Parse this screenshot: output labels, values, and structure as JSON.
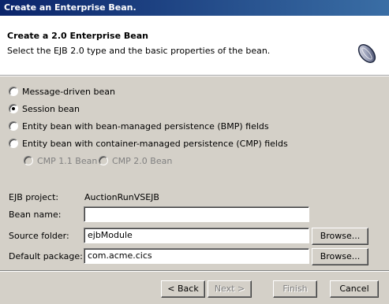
{
  "window": {
    "title": "Create an Enterprise Bean."
  },
  "header": {
    "title": "Create a 2.0 Enterprise Bean",
    "description": "Select the EJB 2.0 type and the basic properties of the bean.",
    "icon": "bean-icon"
  },
  "bean_types": [
    {
      "label": "Message-driven bean",
      "checked": false,
      "enabled": true
    },
    {
      "label": "Session bean",
      "checked": true,
      "enabled": true
    },
    {
      "label": "Entity bean with bean-managed persistence (BMP) fields",
      "checked": false,
      "enabled": true
    },
    {
      "label": "Entity bean with container-managed persistence (CMP) fields",
      "checked": false,
      "enabled": true
    }
  ],
  "cmp_versions": [
    {
      "label": "CMP 1.1 Bean",
      "checked": false,
      "enabled": false
    },
    {
      "label": "CMP 2.0 Bean",
      "checked": false,
      "enabled": false
    }
  ],
  "form": {
    "ejb_project": {
      "label": "EJB project:",
      "value": "AuctionRunVSEJB"
    },
    "bean_name": {
      "label": "Bean name:",
      "value": ""
    },
    "source_folder": {
      "label": "Source folder:",
      "value": "ejbModule",
      "button": "Browse..."
    },
    "default_package": {
      "label": "Default package:",
      "value": "com.acme.cics",
      "button": "Browse..."
    }
  },
  "footer": {
    "back": "< Back",
    "next": "Next >",
    "finish": "Finish",
    "cancel": "Cancel"
  }
}
